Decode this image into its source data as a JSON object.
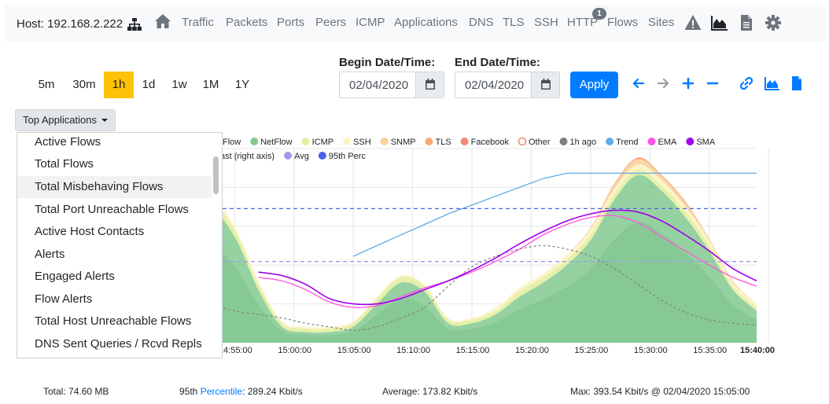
{
  "navbar": {
    "host_label": "Host: 192.168.2.222",
    "links": [
      "Traffic",
      "Packets",
      "Ports",
      "Peers",
      "ICMP",
      "Applications",
      "DNS",
      "TLS",
      "SSH",
      "HTTP",
      "Flows",
      "Sites"
    ],
    "http_badge": "1",
    "icons": [
      "network-icon",
      "home-icon",
      "alert-icon",
      "area-chart-icon",
      "file-icon",
      "gear-icon"
    ]
  },
  "time_range": {
    "buttons": [
      "5m",
      "30m",
      "1h",
      "1d",
      "1w",
      "1M",
      "1Y"
    ],
    "selected": "1h"
  },
  "dates": {
    "begin_label": "Begin Date/Time:",
    "begin_value": "02/04/2020",
    "end_label": "End Date/Time:",
    "end_value": "02/04/2020",
    "apply_label": "Apply"
  },
  "toolbar_icons": [
    "arrow-left-icon",
    "arrow-right-icon",
    "plus-icon",
    "minus-icon",
    "link-icon",
    "area-chart-icon",
    "file-icon"
  ],
  "colors": {
    "accent": "#007bff",
    "selected": "#ffc107",
    "netflow": "#84c991",
    "icmp": "#e3eea0",
    "ssh": "#fbf3c4",
    "snmp": "#fbd29a",
    "tls": "#f6a978",
    "facebook": "#f28a73",
    "one_h_ago": "#808080",
    "trend": "#5dade2",
    "ema": "#ff55e0",
    "sma": "#a100ea",
    "avg": "#a09ae6",
    "perc95": "#4a63e6"
  },
  "dropdown": {
    "label": "Top Applications",
    "items": [
      "Active Flows",
      "Total Flows",
      "Total Misbehaving Flows",
      "Total Port Unreachable Flows",
      "Active Host Contacts",
      "Alerts",
      "Engaged Alerts",
      "Flow Alerts",
      "Total Host Unreachable Flows",
      "DNS Sent Queries / Rcvd Repls"
    ],
    "hovered": "Total Misbehaving Flows"
  },
  "chart_data": {
    "type": "area",
    "legend_row1": [
      "Flow",
      "NetFlow",
      "ICMP",
      "SSH",
      "SNMP",
      "TLS",
      "Facebook",
      "Other",
      "1h ago",
      "Trend",
      "EMA",
      "SMA"
    ],
    "legend_row2": [
      "ast (right axis)",
      "Avg",
      "95th Perc"
    ],
    "x_ticks": [
      "14:55:00",
      "15:00:00",
      "15:05:00",
      "15:10:00",
      "15:15:00",
      "15:20:00",
      "15:25:00",
      "15:30:00",
      "15:35:00",
      "15:40:00"
    ],
    "x": [
      "14:52",
      "14:54",
      "14:56",
      "14:58",
      "15:00",
      "15:02",
      "15:04",
      "15:06",
      "15:08",
      "15:10",
      "15:12",
      "15:14",
      "15:16",
      "15:18",
      "15:20",
      "15:22",
      "15:24",
      "15:26",
      "15:28",
      "15:30",
      "15:32",
      "15:34",
      "15:36",
      "15:38",
      "15:40"
    ],
    "series": [
      {
        "name": "NetFlow",
        "values": [
          0.55,
          0.74,
          0.6,
          0.3,
          0.09,
          0.06,
          0.06,
          0.09,
          0.22,
          0.34,
          0.29,
          0.11,
          0.11,
          0.16,
          0.26,
          0.34,
          0.44,
          0.58,
          0.81,
          0.95,
          0.86,
          0.71,
          0.52,
          0.3,
          0.18
        ]
      },
      {
        "name": "ICMP",
        "values": [
          0.04,
          0.04,
          0.04,
          0.03,
          0.02,
          0.02,
          0.02,
          0.02,
          0.03,
          0.03,
          0.03,
          0.02,
          0.02,
          0.02,
          0.03,
          0.03,
          0.03,
          0.03,
          0.03,
          0.03,
          0.03,
          0.03,
          0.03,
          0.02,
          0.02
        ]
      },
      {
        "name": "SSH",
        "values": [
          0.02,
          0.02,
          0.02,
          0.02,
          0.01,
          0.01,
          0.01,
          0.01,
          0.01,
          0.01,
          0.01,
          0.01,
          0.01,
          0.02,
          0.02,
          0.02,
          0.03,
          0.03,
          0.03,
          0.03,
          0.03,
          0.03,
          0.03,
          0.02,
          0.02
        ]
      },
      {
        "name": "SNMP",
        "values": [
          0.0,
          0.0,
          0.0,
          0.0,
          0.0,
          0.0,
          0.0,
          0.0,
          0.0,
          0.0,
          0.0,
          0.0,
          0.0,
          0.0,
          0.0,
          0.0,
          0.0,
          0.01,
          0.02,
          0.03,
          0.02,
          0.02,
          0.01,
          0.01,
          0.0
        ]
      },
      {
        "name": "TLS",
        "values": [
          0.0,
          0.0,
          0.0,
          0.0,
          0.0,
          0.0,
          0.0,
          0.0,
          0.0,
          0.0,
          0.0,
          0.0,
          0.0,
          0.0,
          0.0,
          0.0,
          0.0,
          0.0,
          0.01,
          0.01,
          0.01,
          0.01,
          0.0,
          0.0,
          0.0
        ]
      }
    ],
    "sma": [
      null,
      null,
      null,
      0.4,
      0.38,
      0.33,
      0.25,
      0.22,
      0.22,
      0.25,
      0.3,
      0.35,
      0.41,
      0.48,
      0.56,
      0.63,
      0.69,
      0.73,
      0.75,
      0.74,
      0.69,
      0.61,
      0.52,
      0.42,
      0.35
    ],
    "ema": [
      null,
      null,
      null,
      0.37,
      0.35,
      0.3,
      0.23,
      0.2,
      0.21,
      0.26,
      0.31,
      0.35,
      0.4,
      0.46,
      0.53,
      0.61,
      0.67,
      0.71,
      0.72,
      0.68,
      0.6,
      0.52,
      0.44,
      0.37,
      0.32
    ],
    "one_h_ago": [
      0.25,
      0.22,
      0.18,
      0.16,
      0.14,
      0.11,
      0.09,
      0.07,
      0.09,
      0.14,
      0.2,
      0.32,
      0.43,
      0.49,
      0.53,
      0.55,
      0.53,
      0.49,
      0.42,
      0.33,
      0.24,
      0.17,
      0.13,
      0.11,
      0.1
    ],
    "trend": [
      null,
      null,
      null,
      null,
      null,
      null,
      null,
      0.49,
      0.55,
      0.61,
      0.67,
      0.73,
      0.78,
      0.83,
      0.88,
      0.93,
      0.96,
      0.96,
      0.96,
      0.96,
      0.96,
      0.96,
      0.96,
      0.96,
      0.96
    ],
    "perc95": 0.76,
    "avg": 0.46,
    "ylim": [
      0,
      1.1
    ],
    "grid": true
  },
  "footer": {
    "total": "Total: 74.60 MB",
    "perc_prefix": "95th ",
    "perc_link": "Percentile",
    "perc_value": ": 289.24 Kbit/s",
    "average": "Average: 173.82 Kbit/s",
    "max": "Max: 393.54 Kbit/s @ 02/04/2020 15:05:00"
  }
}
